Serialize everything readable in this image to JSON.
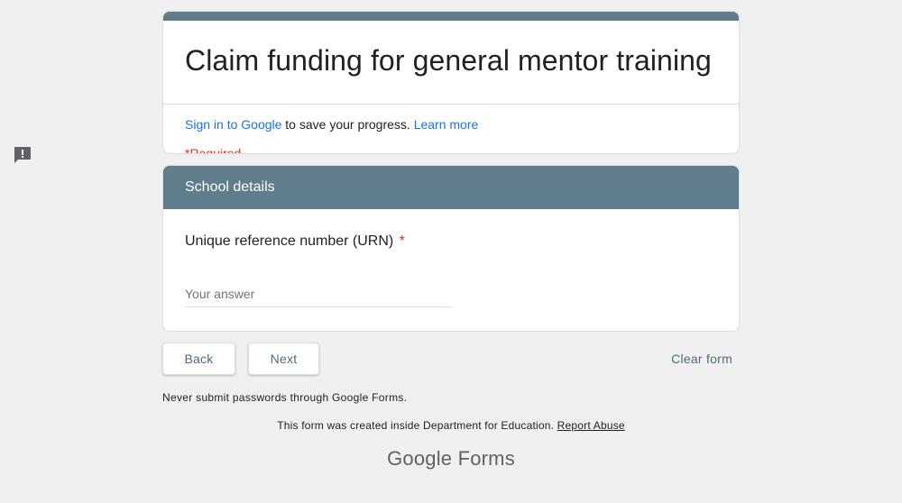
{
  "form": {
    "title": "Claim funding for general mentor training",
    "signin_link": "Sign in to Google",
    "signin_text": " to save your progress. ",
    "learn_more": "Learn more",
    "required_note": "*Required"
  },
  "section": {
    "header": "School details",
    "question": {
      "label": "Unique reference number (URN)",
      "required_marker": "*",
      "placeholder": "Your answer",
      "value": ""
    }
  },
  "actions": {
    "back_label": "Back",
    "next_label": "Next",
    "clear_label": "Clear form"
  },
  "footer": {
    "password_note": "Never submit passwords through Google Forms.",
    "created_text": "This form was created inside Department for Education. ",
    "report_abuse": "Report Abuse",
    "brand_google": "Google",
    "brand_forms": "Forms"
  },
  "icons": {
    "report": "report-problem-icon"
  },
  "colors": {
    "theme": "#607d8b",
    "link": "#1a73e8",
    "required": "#d93025",
    "background": "#f0f0f0"
  }
}
